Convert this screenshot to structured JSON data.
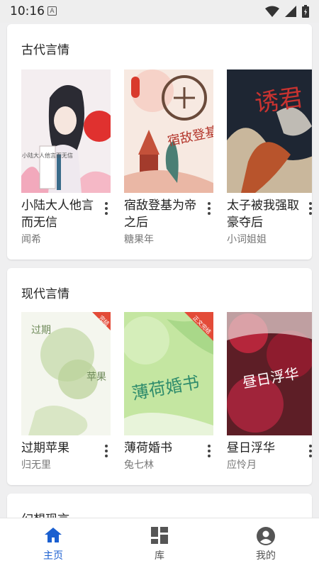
{
  "status_bar": {
    "time": "10:16",
    "notification_letter": "A"
  },
  "sections": [
    {
      "title": "古代言情",
      "books": [
        {
          "title": "小陆大人他言而无信",
          "author": "闻希",
          "cover_text": "小陆大人他言而无信"
        },
        {
          "title": "宿敌登基为帝之后",
          "author": "糖果年",
          "cover_text": "宿敌登基"
        },
        {
          "title": "太子被我强取豪夺后",
          "author": "小词姐姐",
          "cover_text": "诱君"
        }
      ]
    },
    {
      "title": "现代言情",
      "books": [
        {
          "title": "过期苹果",
          "author": "归无里",
          "cover_text": "过期",
          "cover_text2": "苹果",
          "badge": "完结"
        },
        {
          "title": "薄荷婚书",
          "author": "兔七林",
          "cover_text": "薄荷婚书",
          "badge": "正文完结"
        },
        {
          "title": "昼日浮华",
          "author": "应怜月",
          "cover_text": "昼日浮华"
        }
      ]
    },
    {
      "title": "幻想现言"
    }
  ],
  "bottom_nav": [
    {
      "label": "主页",
      "icon": "home-icon",
      "active": true
    },
    {
      "label": "库",
      "icon": "library-grid-icon",
      "active": false
    },
    {
      "label": "我的",
      "icon": "account-icon",
      "active": false
    }
  ],
  "colors": {
    "accent": "#1a5fd0",
    "background": "#efeff0"
  }
}
